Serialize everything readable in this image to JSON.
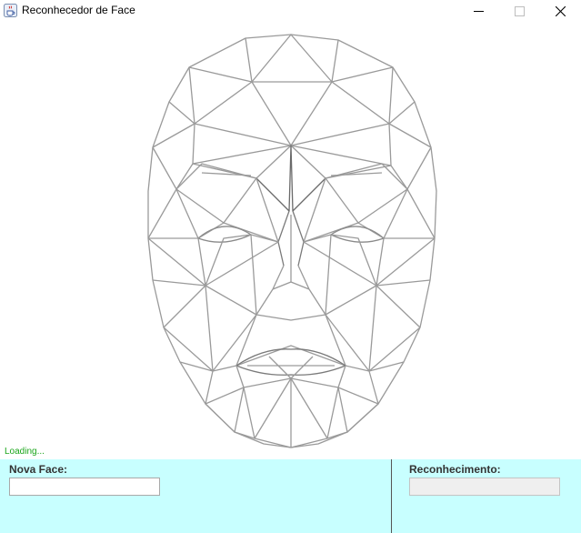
{
  "window": {
    "title": "Reconhecedor de Face",
    "icon": "java-cup-icon",
    "controls": [
      "minimize-icon",
      "maximize-icon",
      "close-icon"
    ]
  },
  "canvas": {
    "description_icon": "face-wireframe-mesh",
    "status_text": "Loading...",
    "status_color": "#1aa51a"
  },
  "panel": {
    "background": "#c8ffff",
    "new_face": {
      "label": "Nova Face:",
      "value": "",
      "placeholder": ""
    },
    "recognition": {
      "label": "Reconhecimento:",
      "value": "",
      "enabled": false
    }
  }
}
